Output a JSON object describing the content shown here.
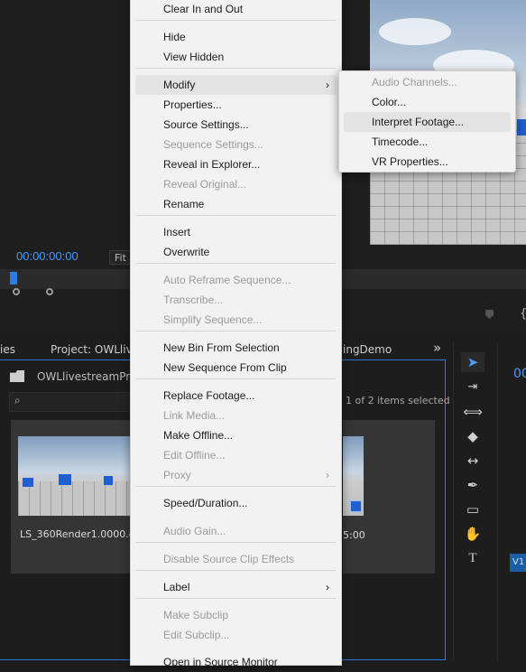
{
  "source_monitor": {
    "timecode": "00:00:00:00",
    "fit_label": "Fit"
  },
  "project_panel": {
    "tab_left": "ies",
    "tab_project": "Project: OWLlives",
    "tab_right": "ingDemo",
    "overflow": "»",
    "bin_path": "OWLlivestreamProm",
    "items_selected": "1 of 2 items selected",
    "clip1_label": "LS_360Render1.0000.exr",
    "clip2_label": "5:00"
  },
  "timeline": {
    "timecode_fragment": "00",
    "track_tag": "V1"
  },
  "context_menu": {
    "items": [
      {
        "label": "Clear In and Out",
        "enabled": true
      },
      {
        "label": "Hide",
        "enabled": true
      },
      {
        "label": "View Hidden",
        "enabled": true
      },
      {
        "label": "Modify",
        "enabled": true,
        "submenu": true,
        "highlighted": true
      },
      {
        "label": "Properties...",
        "enabled": true
      },
      {
        "label": "Source Settings...",
        "enabled": true
      },
      {
        "label": "Sequence Settings...",
        "enabled": false
      },
      {
        "label": "Reveal in Explorer...",
        "enabled": true
      },
      {
        "label": "Reveal Original...",
        "enabled": false
      },
      {
        "label": "Rename",
        "enabled": true
      },
      {
        "label": "Insert",
        "enabled": true
      },
      {
        "label": "Overwrite",
        "enabled": true
      },
      {
        "label": "Auto Reframe Sequence...",
        "enabled": false
      },
      {
        "label": "Transcribe...",
        "enabled": false
      },
      {
        "label": "Simplify Sequence...",
        "enabled": false
      },
      {
        "label": "New Bin From Selection",
        "enabled": true
      },
      {
        "label": "New Sequence From Clip",
        "enabled": true
      },
      {
        "label": "Replace Footage...",
        "enabled": true
      },
      {
        "label": "Link Media...",
        "enabled": false
      },
      {
        "label": "Make Offline...",
        "enabled": true
      },
      {
        "label": "Edit Offline...",
        "enabled": false
      },
      {
        "label": "Proxy",
        "enabled": false,
        "submenu": true
      },
      {
        "label": "Speed/Duration...",
        "enabled": true
      },
      {
        "label": "Audio Gain...",
        "enabled": false
      },
      {
        "label": "Disable Source Clip Effects",
        "enabled": false
      },
      {
        "label": "Label",
        "enabled": true,
        "submenu": true
      },
      {
        "label": "Make Subclip",
        "enabled": false
      },
      {
        "label": "Edit Subclip...",
        "enabled": false
      },
      {
        "label": "Open in Source Monitor",
        "enabled": true
      }
    ],
    "submenu_arrow": "›"
  },
  "modify_submenu": {
    "items": [
      {
        "label": "Audio Channels...",
        "enabled": false
      },
      {
        "label": "Color...",
        "enabled": true
      },
      {
        "label": "Interpret Footage...",
        "enabled": true,
        "highlighted": true
      },
      {
        "label": "Timecode...",
        "enabled": true
      },
      {
        "label": "VR Properties...",
        "enabled": true
      }
    ]
  },
  "tool_icons": [
    "selection-tool-icon",
    "track-select-icon",
    "ripple-edit-icon",
    "razor-icon",
    "slip-icon",
    "pen-icon",
    "rectangle-icon",
    "hand-icon",
    "type-icon"
  ]
}
